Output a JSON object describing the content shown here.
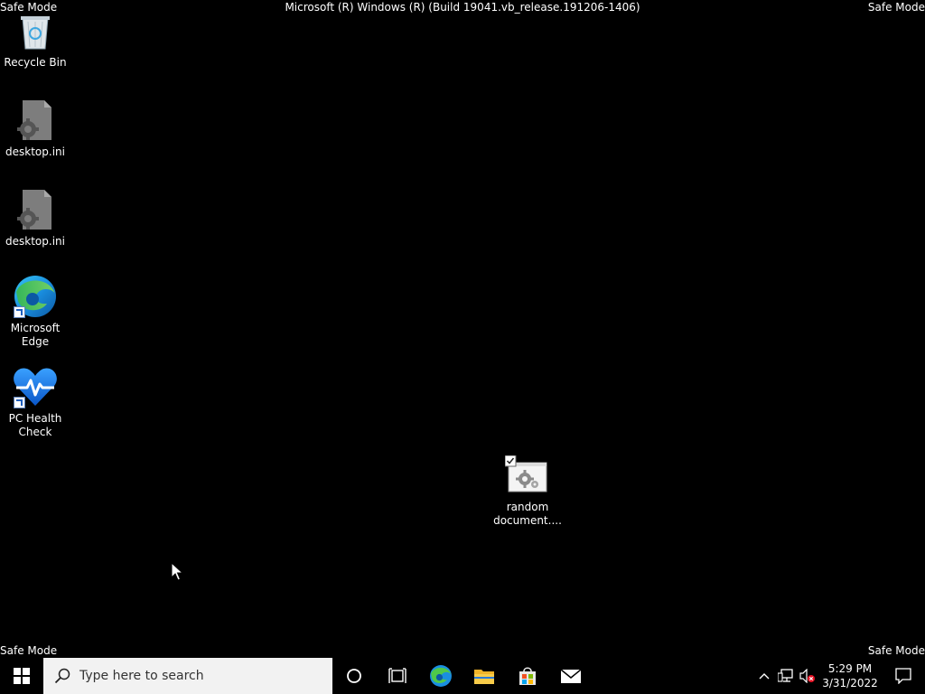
{
  "watermark": {
    "top_left": "Safe Mode",
    "top_right": "Safe Mode",
    "bottom_left": "Safe Mode",
    "bottom_right": "Safe Mode",
    "build": "Microsoft (R) Windows (R) (Build 19041.vb_release.191206-1406)"
  },
  "desktop_icons": [
    {
      "label": "Recycle Bin",
      "icon": "recycle-bin-icon"
    },
    {
      "label": "desktop.ini",
      "icon": "settings-file-icon"
    },
    {
      "label": "desktop.ini",
      "icon": "settings-file-icon"
    },
    {
      "label": "Microsoft\nEdge",
      "icon": "edge-icon"
    },
    {
      "label": "PC Health\nCheck",
      "icon": "pc-health-check-icon"
    },
    {
      "label": "random\ndocument....",
      "icon": "document-settings-icon"
    }
  ],
  "taskbar": {
    "search_placeholder": "Type here to search",
    "pinned": [
      "start-icon",
      "cortana-icon",
      "task-view-icon",
      "edge-icon",
      "file-explorer-icon",
      "store-icon",
      "mail-icon"
    ],
    "clock_time": "5:29 PM",
    "clock_date": "3/31/2022"
  },
  "colors": {
    "background": "#000000",
    "taskbar": "#000000",
    "search_box": "#f2f2f2"
  }
}
